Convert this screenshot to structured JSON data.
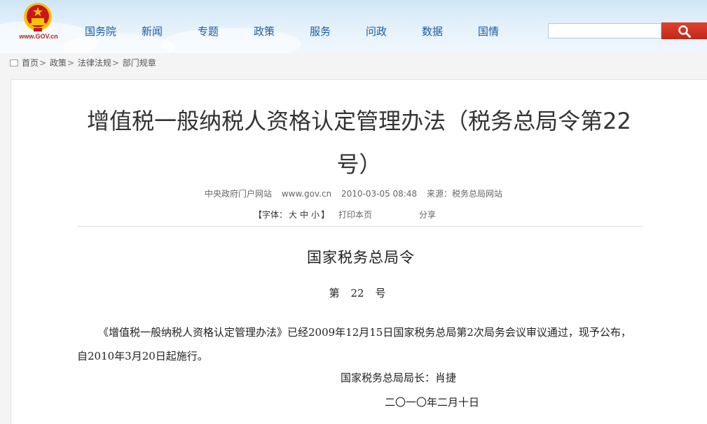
{
  "header": {
    "site_mark": "www.GOV.cn",
    "search": {
      "value": "",
      "placeholder": ""
    },
    "colors": {
      "nav_text": "#1c5aa6",
      "search_button": "#c0281b",
      "emblem_red": "#c8161d",
      "emblem_gold": "#f5c400"
    }
  },
  "nav": {
    "items": [
      {
        "label": "国务院"
      },
      {
        "label": "新闻"
      },
      {
        "label": "专题"
      },
      {
        "label": "政策"
      },
      {
        "label": "服务"
      },
      {
        "label": "问政"
      },
      {
        "label": "数据"
      },
      {
        "label": "国情"
      }
    ]
  },
  "breadcrumb": {
    "items": [
      "首页",
      "政策",
      "法律法规",
      "部门规章"
    ],
    "separator": ">"
  },
  "article": {
    "title": "增值税一般纳税人资格认定管理办法（税务总局令第22号）",
    "meta": {
      "publisher": "中央政府门户网站",
      "site": "www.gov.cn",
      "datetime": "2010-03-05 08:48",
      "source_label": "来源：",
      "source": "税务总局网站"
    },
    "tools": {
      "font_prefix": "【字体：",
      "font_large": "大",
      "font_medium": "中",
      "font_small": "小",
      "font_suffix": "】",
      "print": "打印本页",
      "share": "分享"
    },
    "heading": "国家税务总局令",
    "number_prefix": "第",
    "number_value": "22",
    "number_suffix": "号",
    "body": "《增值税一般纳税人资格认定管理办法》已经2009年12月15日国家税务总局第2次局务会议审议通过，现予公布，自2010年3月20日起施行。",
    "signature": "国家税务总局局长：肖捷",
    "date": "二〇一〇年二月十日"
  }
}
